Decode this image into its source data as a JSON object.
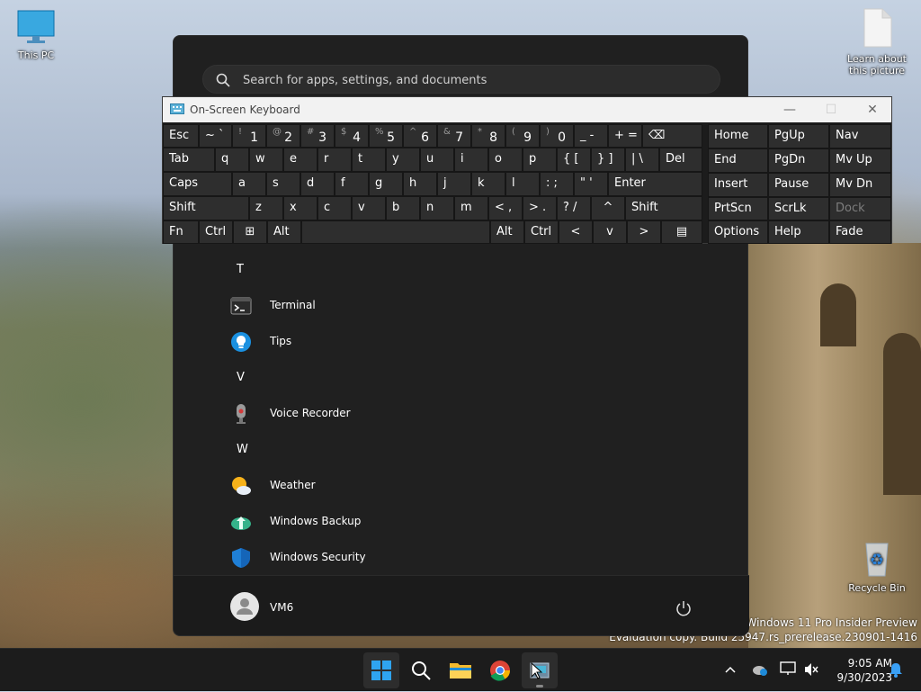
{
  "desktop": {
    "icons": [
      {
        "label": "This PC"
      },
      {
        "label": "Learn about this picture"
      },
      {
        "label": "Recycle Bin"
      }
    ],
    "watermark": {
      "line1": "Windows 11 Pro Insider Preview",
      "line2": "Evaluation copy. Build 25947.rs_prerelease.230901-1416"
    }
  },
  "start_menu": {
    "search_placeholder": "Search for apps, settings, and documents",
    "apps": [
      {
        "type": "letter",
        "label": "T"
      },
      {
        "type": "app",
        "label": "Terminal",
        "icon": "terminal-icon"
      },
      {
        "type": "app",
        "label": "Tips",
        "icon": "tips-icon"
      },
      {
        "type": "letter",
        "label": "V"
      },
      {
        "type": "app",
        "label": "Voice Recorder",
        "icon": "voice-recorder-icon"
      },
      {
        "type": "letter",
        "label": "W"
      },
      {
        "type": "app",
        "label": "Weather",
        "icon": "weather-icon"
      },
      {
        "type": "app",
        "label": "Windows Backup",
        "icon": "windows-backup-icon"
      },
      {
        "type": "app",
        "label": "Windows Security",
        "icon": "windows-security-icon"
      }
    ],
    "user": {
      "name": "VM6"
    }
  },
  "osk": {
    "title": "On-Screen Keyboard",
    "row1": [
      {
        "main": "Esc"
      },
      {
        "main": "~ `"
      },
      {
        "sup": "!",
        "sub": "1"
      },
      {
        "sup": "@",
        "sub": "2"
      },
      {
        "sup": "#",
        "sub": "3"
      },
      {
        "sup": "$",
        "sub": "4"
      },
      {
        "sup": "%",
        "sub": "5"
      },
      {
        "sup": "^",
        "sub": "6"
      },
      {
        "sup": "&",
        "sub": "7"
      },
      {
        "sup": "*",
        "sub": "8"
      },
      {
        "sup": "(",
        "sub": "9"
      },
      {
        "sup": ")",
        "sub": "0"
      },
      {
        "main": "_ -"
      },
      {
        "main": "+ ="
      },
      {
        "main": "⌫"
      }
    ],
    "row2": [
      "Tab",
      "q",
      "w",
      "e",
      "r",
      "t",
      "y",
      "u",
      "i",
      "o",
      "p",
      "{ [",
      "} ]",
      "| \\",
      "Del"
    ],
    "row3": [
      "Caps",
      "a",
      "s",
      "d",
      "f",
      "g",
      "h",
      "j",
      "k",
      "l",
      ": ;",
      "\" '",
      "Enter"
    ],
    "row4": [
      "Shift",
      "z",
      "x",
      "c",
      "v",
      "b",
      "n",
      "m",
      "< ,",
      "> .",
      "? /",
      "^",
      "Shift"
    ],
    "row5": [
      "Fn",
      "Ctrl",
      "⊞",
      "Alt",
      "",
      "Alt",
      "Ctrl",
      "<",
      "v",
      ">",
      "▤"
    ],
    "nav": [
      [
        "Home",
        "PgUp",
        "Nav"
      ],
      [
        "End",
        "PgDn",
        "Mv Up"
      ],
      [
        "Insert",
        "Pause",
        "Mv Dn"
      ],
      [
        "PrtScn",
        "ScrLk",
        "Dock"
      ],
      [
        "Options",
        "Help",
        "Fade"
      ]
    ]
  },
  "taskbar": {
    "time": "9:05 AM",
    "date": "9/30/2023"
  }
}
